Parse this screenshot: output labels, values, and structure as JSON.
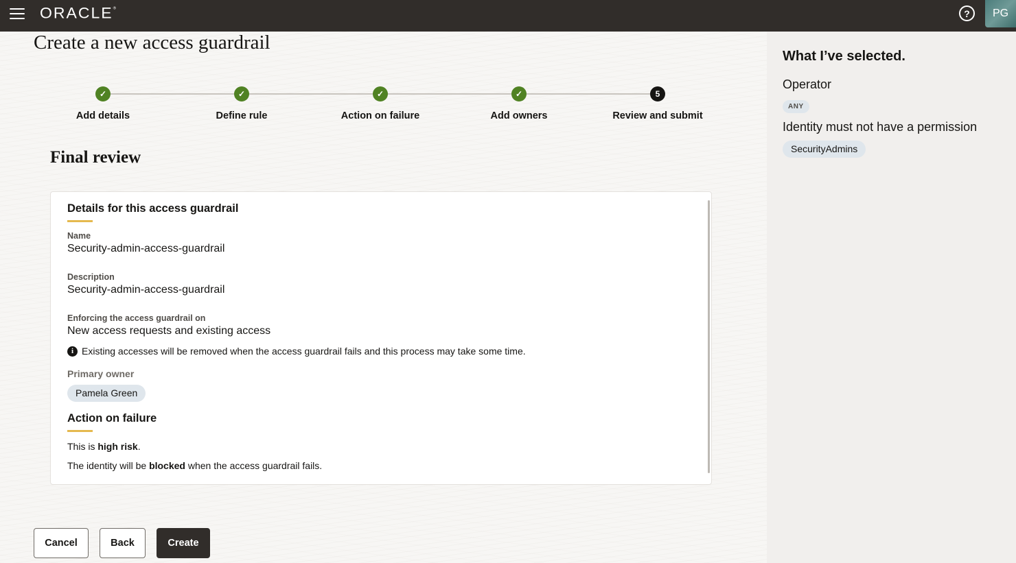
{
  "header": {
    "logo_text": "ORACLE",
    "logo_mark": "®",
    "help_label": "?",
    "user_initials": "PG"
  },
  "page": {
    "title": "Create a new access guardrail"
  },
  "stepper": {
    "steps": [
      {
        "label": "Add details",
        "status": "complete",
        "marker": "✓"
      },
      {
        "label": "Define rule",
        "status": "complete",
        "marker": "✓"
      },
      {
        "label": "Action on failure",
        "status": "complete",
        "marker": "✓"
      },
      {
        "label": "Add owners",
        "status": "complete",
        "marker": "✓"
      },
      {
        "label": "Review and submit",
        "status": "current",
        "marker": "5"
      }
    ]
  },
  "review": {
    "section_title": "Final review",
    "details_heading": "Details for this access guardrail",
    "name_label": "Name",
    "name_value": "Security-admin-access-guardrail",
    "description_label": "Description",
    "description_value": "Security-admin-access-guardrail",
    "enforcing_label": "Enforcing the access guardrail on",
    "enforcing_value": "New access requests and existing access",
    "info_text": "Existing accesses will be removed when the access guardrail fails and this process may take some time.",
    "primary_owner_label": "Primary owner",
    "primary_owner_value": "Pamela Green",
    "action_heading": "Action on failure",
    "risk_prefix": "This is ",
    "risk_value": "high risk",
    "risk_suffix": ".",
    "blocked_prefix": "The identity will be ",
    "blocked_value": "blocked",
    "blocked_suffix": " when the access guardrail fails."
  },
  "actions": {
    "cancel_label": "Cancel",
    "back_label": "Back",
    "create_label": "Create"
  },
  "side_panel": {
    "title": "What I’ve selected.",
    "operator_label": "Operator",
    "operator_value": "ANY",
    "condition_label": "Identity must not have a permission",
    "condition_value": "SecurityAdmins"
  },
  "colors": {
    "header_bg": "#312d2a",
    "step_complete": "#508223",
    "step_current": "#161513",
    "accent_underline": "#e5b94e",
    "chip_bg": "#dfe6ec"
  }
}
